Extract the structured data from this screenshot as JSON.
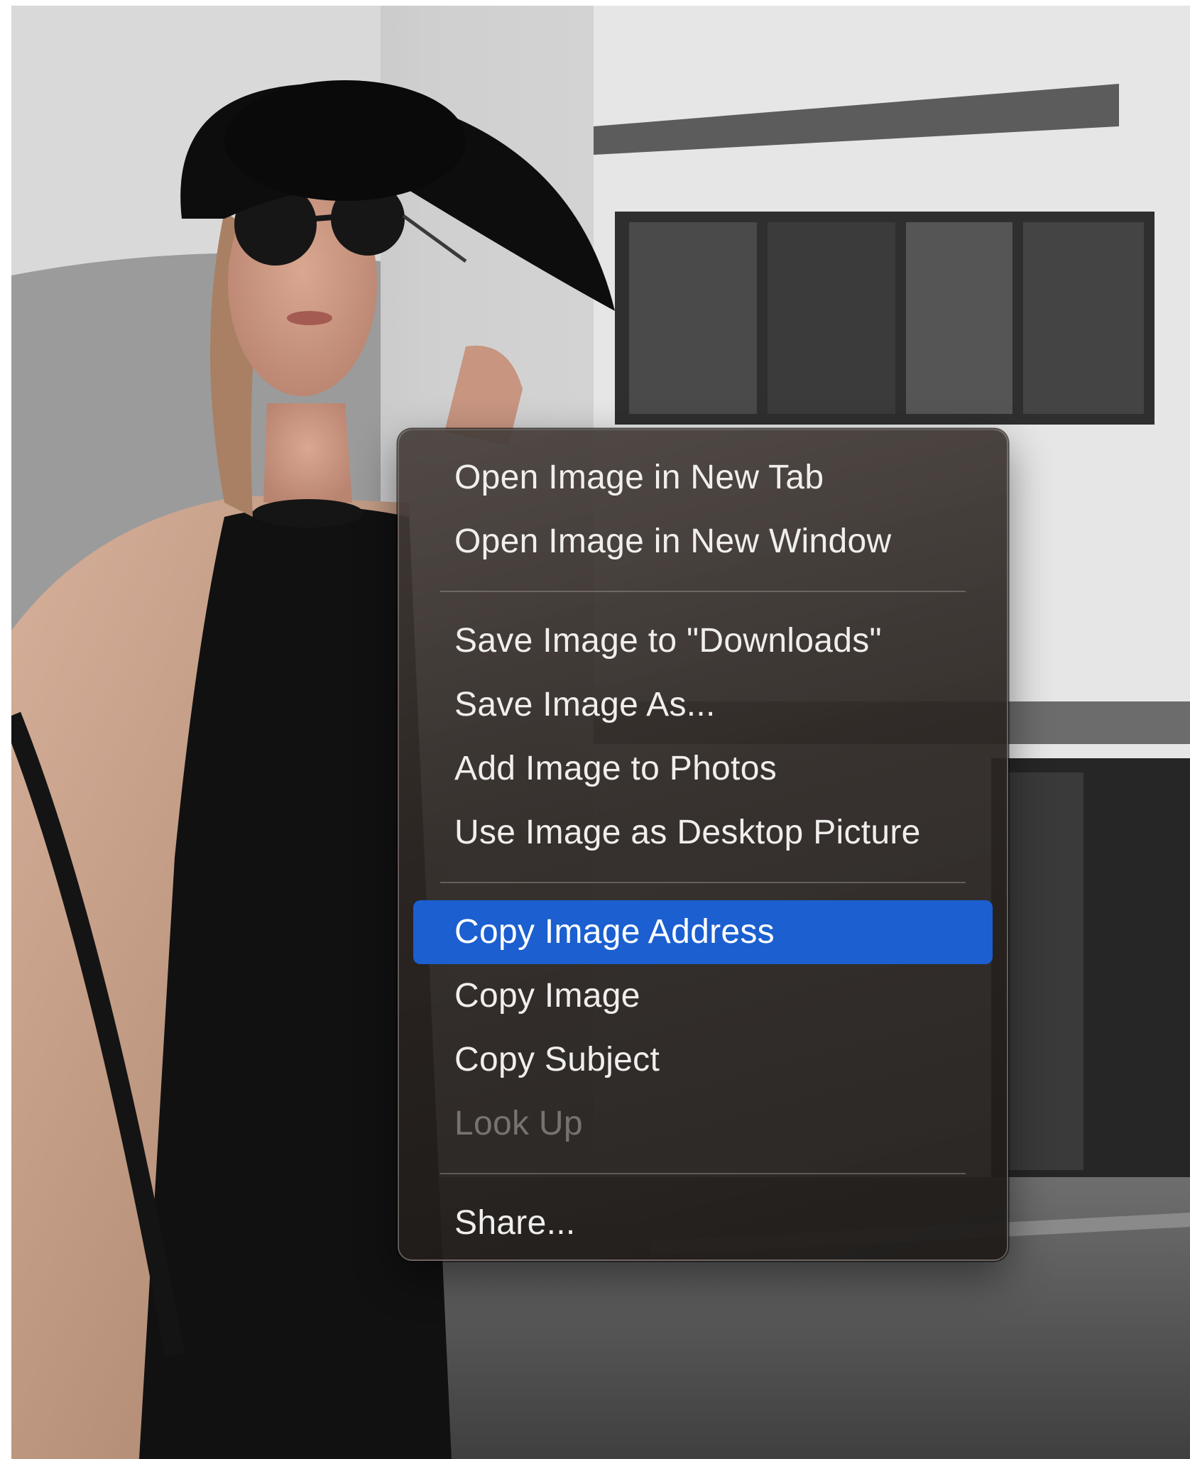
{
  "colors": {
    "highlight": "#1b5fd0",
    "menu_background": "#2e2825",
    "menu_text": "#f1efed",
    "menu_text_disabled": "#7f7a77"
  },
  "context_menu": {
    "groups": [
      {
        "items": [
          {
            "label": "Open Image in New Tab",
            "state": "normal"
          },
          {
            "label": "Open Image in New Window",
            "state": "normal"
          }
        ]
      },
      {
        "items": [
          {
            "label": "Save Image to \"Downloads\"",
            "state": "normal"
          },
          {
            "label": "Save Image As...",
            "state": "normal"
          },
          {
            "label": "Add Image to Photos",
            "state": "normal"
          },
          {
            "label": "Use Image as Desktop Picture",
            "state": "normal"
          }
        ]
      },
      {
        "items": [
          {
            "label": "Copy Image Address",
            "state": "highlighted"
          },
          {
            "label": "Copy Image",
            "state": "normal"
          },
          {
            "label": "Copy Subject",
            "state": "normal"
          },
          {
            "label": "Look Up",
            "state": "disabled"
          }
        ]
      },
      {
        "items": [
          {
            "label": "Share...",
            "state": "normal"
          }
        ]
      }
    ]
  }
}
